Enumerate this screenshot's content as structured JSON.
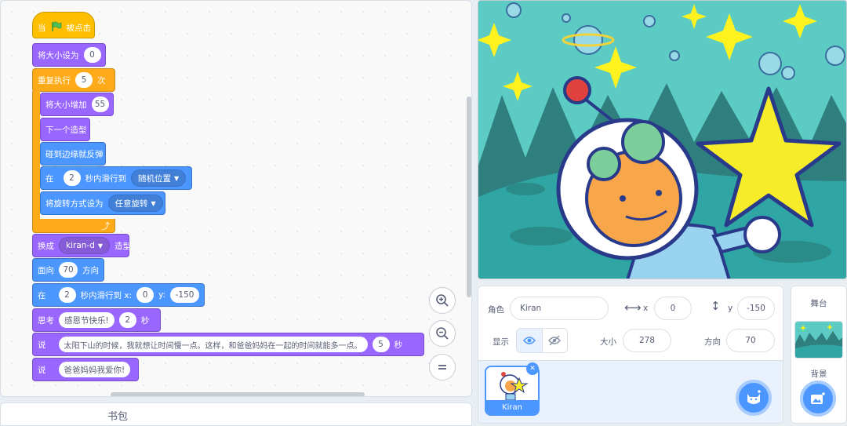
{
  "code": {
    "when_label": "当",
    "clicked_label": "被点击",
    "set_size_label": "将大小设为",
    "set_size_value": "0",
    "repeat_label": "重复执行",
    "repeat_value": "5",
    "repeat_unit": "次",
    "change_size_label": "将大小增加",
    "change_size_value": "55",
    "next_costume_label": "下一个造型",
    "bounce_label": "碰到边缘就反弹",
    "glide_label_pre": "在",
    "glide_secs_value": "2",
    "glide_label_mid": "秒内滑行到",
    "glide_target": "随机位置",
    "rotation_label": "将旋转方式设为",
    "rotation_value": "任意旋转",
    "switch_costume_label": "换成",
    "costume_value": "kiran-d",
    "costume_unit": "造型",
    "point_label": "面向",
    "direction_value": "70",
    "direction_unit": "方向",
    "glide_xy_pre": "在",
    "glide_xy_secs": "2",
    "glide_xy_mid": "秒内滑行到 x:",
    "glide_x_value": "0",
    "glide_y_label": "y:",
    "glide_y_value": "-150",
    "think_label": "思考",
    "think_text": "感恩节快乐!",
    "think_secs": "2",
    "think_unit": "秒",
    "say_label": "说",
    "say_text": "太阳下山的时候，我就想让时间慢一点。这样，和爸爸妈妈在一起的时间就能多一点。",
    "say_secs": "5",
    "say_unit": "秒",
    "say2_label": "说",
    "say2_text": "爸爸妈妈我爱你!"
  },
  "zoom": {
    "in_icon": "zoom-in-icon",
    "out_icon": "zoom-out-icon",
    "reset_icon": "equals-icon"
  },
  "backpack_label": "书包",
  "sprite_info": {
    "sprite_label": "角色",
    "sprite_name": "Kiran",
    "x_label": "x",
    "x_value": "0",
    "y_label": "y",
    "y_value": "-150",
    "show_label": "显示",
    "size_label": "大小",
    "size_value": "278",
    "direction_label": "方向",
    "direction_value": "70"
  },
  "sprites": [
    {
      "name": "Kiran"
    }
  ],
  "stage_panel": {
    "title": "舞台",
    "backdrops_label": "背景"
  },
  "colors": {
    "events": "#ffbf00",
    "control": "#ffab19",
    "looks": "#9966ff",
    "motion": "#4c97ff",
    "stage_bg": "#5cc8c0"
  }
}
